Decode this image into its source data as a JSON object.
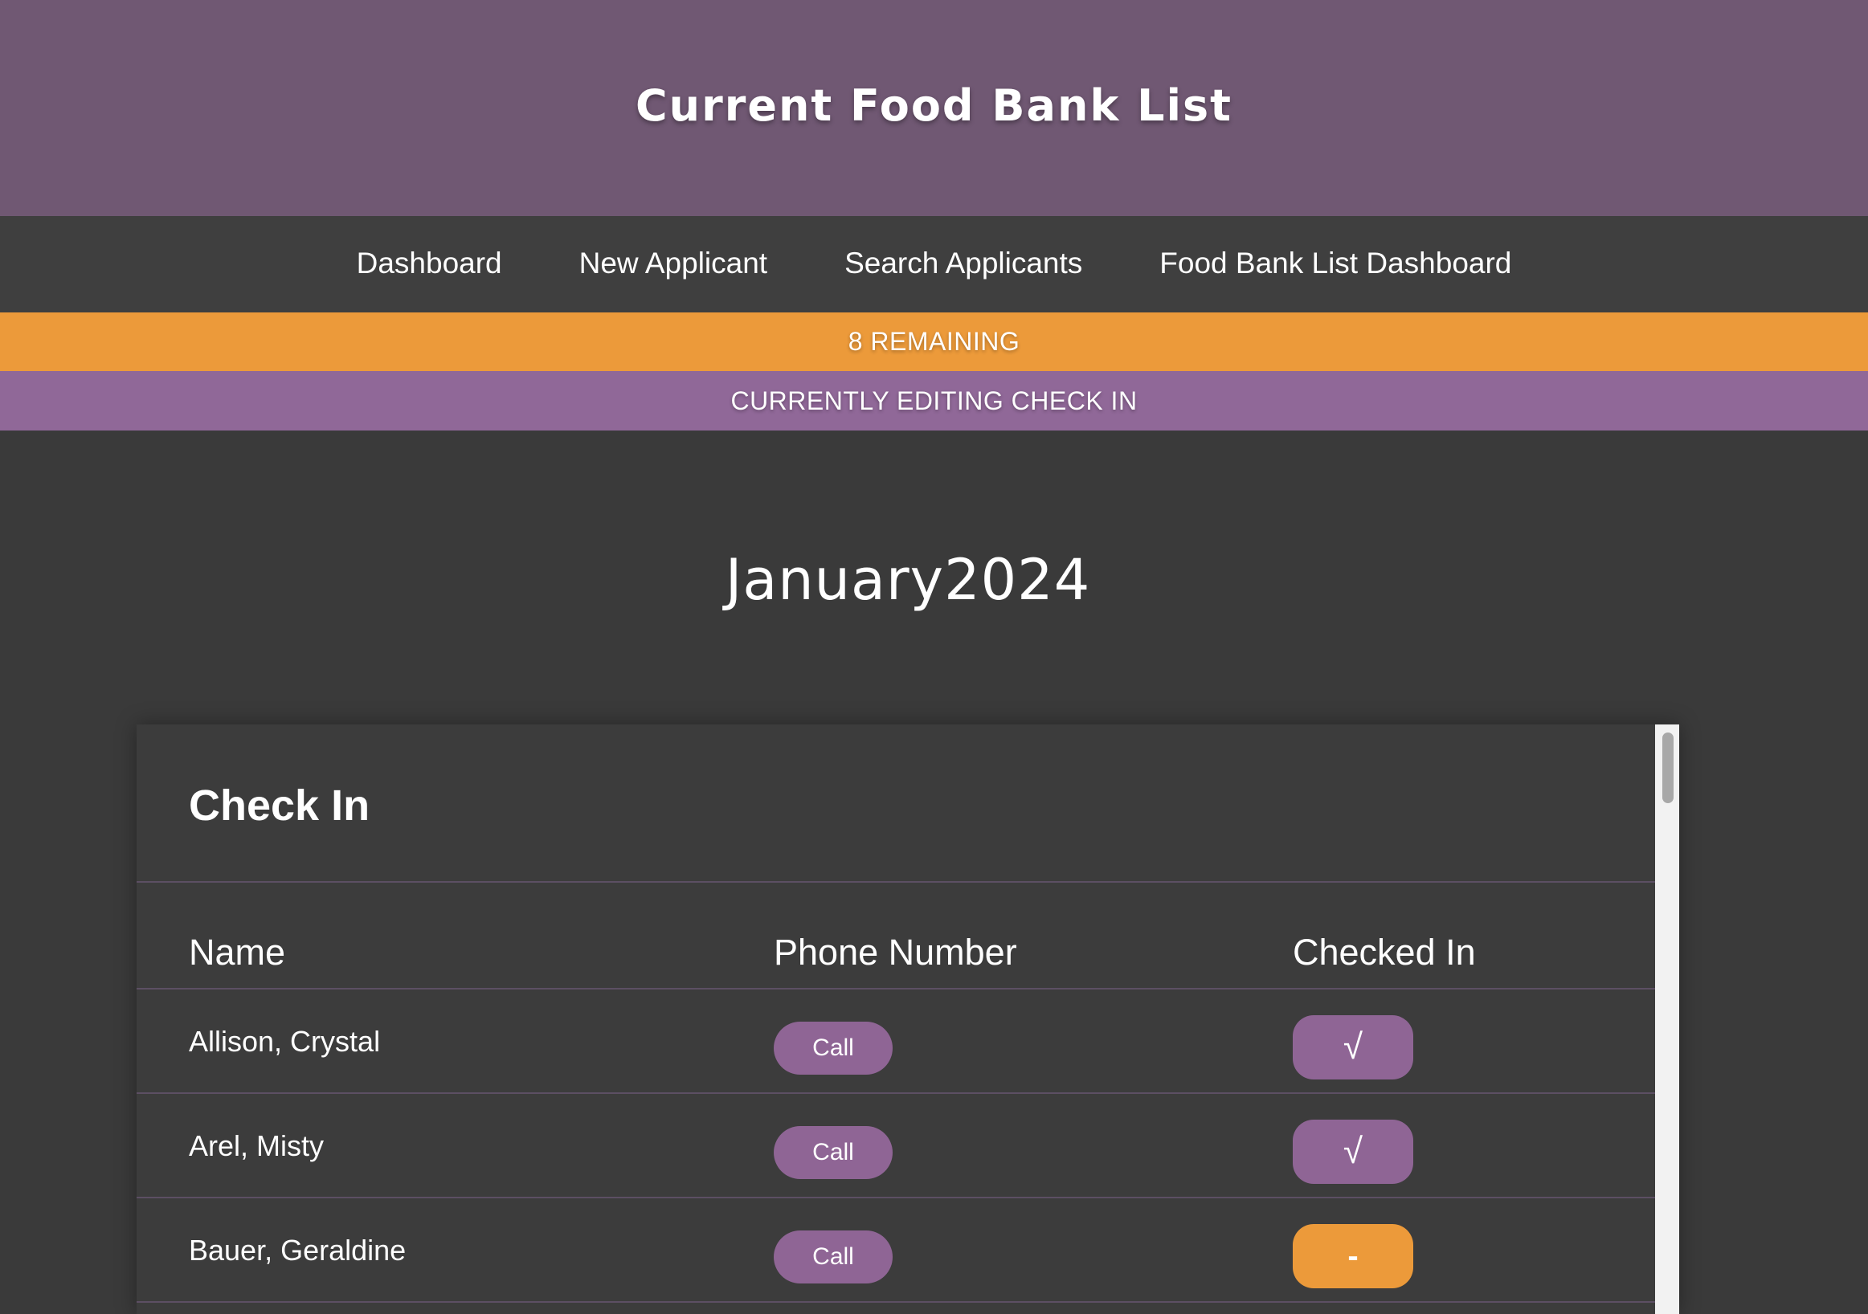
{
  "header": {
    "title": "Current Food Bank List"
  },
  "nav": {
    "items": [
      {
        "label": "Dashboard"
      },
      {
        "label": "New Applicant"
      },
      {
        "label": "Search Applicants"
      },
      {
        "label": "Food Bank List Dashboard"
      }
    ]
  },
  "banners": {
    "remaining": "8 REMAINING",
    "editing": "CURRENTLY EDITING CHECK IN"
  },
  "colors": {
    "header_bg": "#705873",
    "accent_orange": "#ec9a3a",
    "accent_purple": "#906898"
  },
  "month_title": "January2024",
  "card": {
    "title": "Check In",
    "columns": {
      "name": "Name",
      "phone": "Phone Number",
      "checked_in": "Checked In"
    },
    "rows": [
      {
        "name": "Allison, Crystal",
        "call_label": "Call",
        "checked_in": "√",
        "status": "checked"
      },
      {
        "name": "Arel, Misty",
        "call_label": "Call",
        "checked_in": "√",
        "status": "checked"
      },
      {
        "name": "Bauer, Geraldine",
        "call_label": "Call",
        "checked_in": "-",
        "status": "not-checked"
      }
    ]
  }
}
